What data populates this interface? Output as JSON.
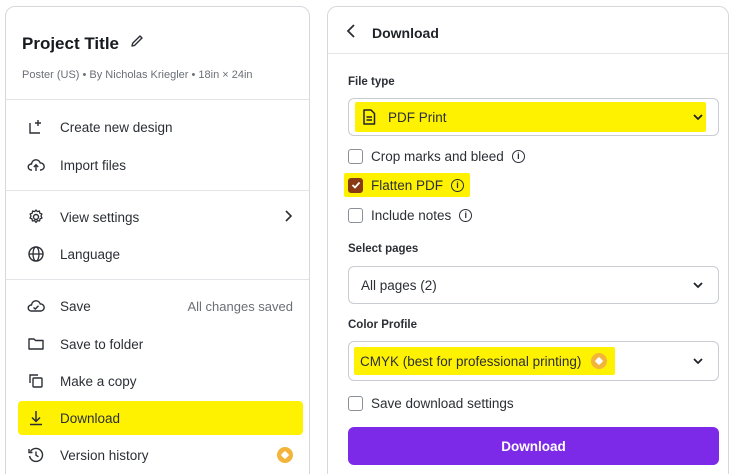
{
  "project": {
    "title": "Project Title",
    "subtitle": "Poster (US) • By Nicholas Kriegler • 18in × 24in"
  },
  "menu": {
    "create": "Create new design",
    "import": "Import files",
    "view_settings": "View settings",
    "language": "Language",
    "save": "Save",
    "save_status": "All changes saved",
    "save_folder": "Save to folder",
    "copy": "Make a copy",
    "download": "Download",
    "version_history": "Version history"
  },
  "download_panel": {
    "title": "Download",
    "file_type_label": "File type",
    "file_type_value": "PDF Print",
    "crop_marks": "Crop marks and bleed",
    "flatten": "Flatten PDF",
    "flatten_checked": true,
    "include_notes": "Include notes",
    "select_pages_label": "Select pages",
    "pages_value": "All pages (2)",
    "color_profile_label": "Color Profile",
    "color_profile_value": "CMYK (best for professional printing)",
    "save_settings": "Save download settings",
    "download_button": "Download"
  },
  "colors": {
    "highlight": "#fff200",
    "accent": "#7d2ae8",
    "premium": "#f2b53a"
  }
}
